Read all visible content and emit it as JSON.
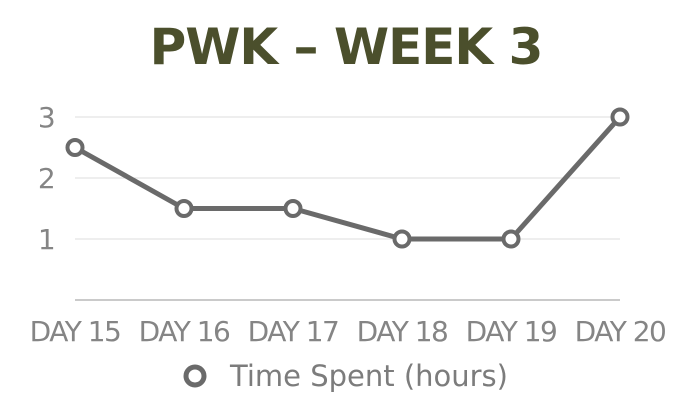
{
  "chart_data": {
    "type": "line",
    "title": "PWK – WEEK 3",
    "categories": [
      "DAY 15",
      "DAY 16",
      "DAY 17",
      "DAY 18",
      "DAY 19",
      "DAY 20"
    ],
    "series": [
      {
        "name": "Time Spent (hours)",
        "values": [
          2.5,
          1.5,
          1.5,
          1,
          1,
          3
        ]
      }
    ],
    "ylim": [
      0,
      3
    ],
    "yticks": [
      "1",
      "2",
      "3"
    ],
    "grid": true,
    "legend_position": "bottom",
    "colors": {
      "title": "#4b4f2c",
      "line": "#6a6a6a",
      "ticks": "#858585",
      "legend_text": "#7c7c7c",
      "grid": "#dedede",
      "axis": "#b8b8b8"
    }
  }
}
